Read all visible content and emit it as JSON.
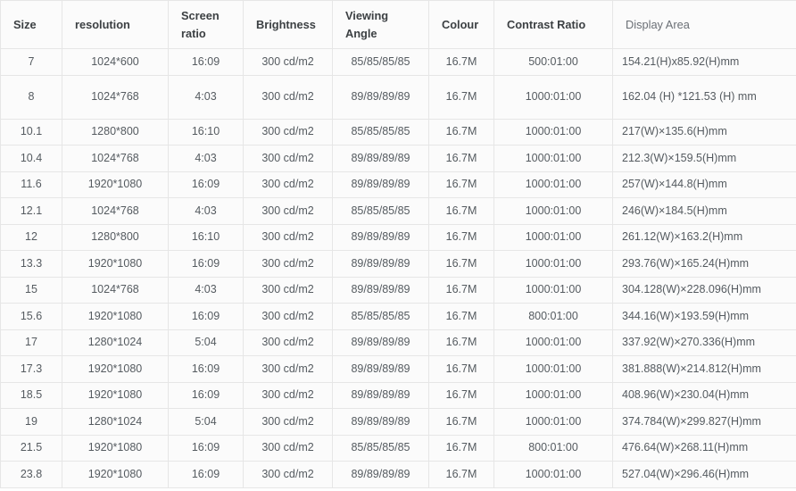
{
  "table": {
    "columns": [
      {
        "key": "size",
        "label": "Size"
      },
      {
        "key": "res",
        "label": "resolution"
      },
      {
        "key": "ratio",
        "label": "Screen\nratio"
      },
      {
        "key": "bright",
        "label": "Brightness"
      },
      {
        "key": "angle",
        "label": "Viewing\nAngle"
      },
      {
        "key": "colour",
        "label": "Colour"
      },
      {
        "key": "contrast",
        "label": "Contrast Ratio"
      },
      {
        "key": "area",
        "label": "Display Area"
      }
    ],
    "headers": {
      "size": "Size",
      "resolution": "resolution",
      "screen_ratio_line1": "Screen",
      "screen_ratio_line2": "ratio",
      "brightness": "Brightness",
      "viewing_angle_line1": "Viewing",
      "viewing_angle_line2": "Angle",
      "colour": "Colour",
      "contrast_ratio": "Contrast Ratio",
      "display_area": "Display Area"
    },
    "rows": [
      {
        "size": "7",
        "resolution": "1024*600",
        "screen_ratio": "16:09",
        "brightness": "300 cd/m2",
        "viewing_angle": "85/85/85/85",
        "colour": "16.7M",
        "contrast_ratio": "500:01:00",
        "display_area": "154.21(H)x85.92(H)mm"
      },
      {
        "size": "8",
        "resolution": "1024*768",
        "screen_ratio": "4:03",
        "brightness": "300 cd/m2",
        "viewing_angle": "89/89/89/89",
        "colour": "16.7M",
        "contrast_ratio": "1000:01:00",
        "display_area": "162.04 (H) *121.53 (H) mm"
      },
      {
        "size": "10.1",
        "resolution": "1280*800",
        "screen_ratio": "16:10",
        "brightness": "300 cd/m2",
        "viewing_angle": "85/85/85/85",
        "colour": "16.7M",
        "contrast_ratio": "1000:01:00",
        "display_area": "217(W)×135.6(H)mm"
      },
      {
        "size": "10.4",
        "resolution": "1024*768",
        "screen_ratio": "4:03",
        "brightness": "300 cd/m2",
        "viewing_angle": "89/89/89/89",
        "colour": "16.7M",
        "contrast_ratio": "1000:01:00",
        "display_area": "212.3(W)×159.5(H)mm"
      },
      {
        "size": "11.6",
        "resolution": "1920*1080",
        "screen_ratio": "16:09",
        "brightness": "300 cd/m2",
        "viewing_angle": "89/89/89/89",
        "colour": "16.7M",
        "contrast_ratio": "1000:01:00",
        "display_area": "257(W)×144.8(H)mm"
      },
      {
        "size": "12.1",
        "resolution": "1024*768",
        "screen_ratio": "4:03",
        "brightness": "300 cd/m2",
        "viewing_angle": "85/85/85/85",
        "colour": "16.7M",
        "contrast_ratio": "1000:01:00",
        "display_area": "246(W)×184.5(H)mm"
      },
      {
        "size": "12",
        "resolution": "1280*800",
        "screen_ratio": "16:10",
        "brightness": "300 cd/m2",
        "viewing_angle": "89/89/89/89",
        "colour": "16.7M",
        "contrast_ratio": "1000:01:00",
        "display_area": "261.12(W)×163.2(H)mm"
      },
      {
        "size": "13.3",
        "resolution": "1920*1080",
        "screen_ratio": "16:09",
        "brightness": "300 cd/m2",
        "viewing_angle": "89/89/89/89",
        "colour": "16.7M",
        "contrast_ratio": "1000:01:00",
        "display_area": "293.76(W)×165.24(H)mm"
      },
      {
        "size": "15",
        "resolution": "1024*768",
        "screen_ratio": "4:03",
        "brightness": "300 cd/m2",
        "viewing_angle": "89/89/89/89",
        "colour": "16.7M",
        "contrast_ratio": "1000:01:00",
        "display_area": "304.128(W)×228.096(H)mm"
      },
      {
        "size": "15.6",
        "resolution": "1920*1080",
        "screen_ratio": "16:09",
        "brightness": "300 cd/m2",
        "viewing_angle": "85/85/85/85",
        "colour": "16.7M",
        "contrast_ratio": "800:01:00",
        "display_area": "344.16(W)×193.59(H)mm"
      },
      {
        "size": "17",
        "resolution": "1280*1024",
        "screen_ratio": "5:04",
        "brightness": "300 cd/m2",
        "viewing_angle": "89/89/89/89",
        "colour": "16.7M",
        "contrast_ratio": "1000:01:00",
        "display_area": "337.92(W)×270.336(H)mm"
      },
      {
        "size": "17.3",
        "resolution": "1920*1080",
        "screen_ratio": "16:09",
        "brightness": "300 cd/m2",
        "viewing_angle": "89/89/89/89",
        "colour": "16.7M",
        "contrast_ratio": "1000:01:00",
        "display_area": "381.888(W)×214.812(H)mm"
      },
      {
        "size": "18.5",
        "resolution": "1920*1080",
        "screen_ratio": "16:09",
        "brightness": "300 cd/m2",
        "viewing_angle": "89/89/89/89",
        "colour": "16.7M",
        "contrast_ratio": "1000:01:00",
        "display_area": "408.96(W)×230.04(H)mm"
      },
      {
        "size": "19",
        "resolution": "1280*1024",
        "screen_ratio": "5:04",
        "brightness": "300 cd/m2",
        "viewing_angle": "89/89/89/89",
        "colour": "16.7M",
        "contrast_ratio": "1000:01:00",
        "display_area": "374.784(W)×299.827(H)mm"
      },
      {
        "size": "21.5",
        "resolution": "1920*1080",
        "screen_ratio": "16:09",
        "brightness": "300 cd/m2",
        "viewing_angle": "85/85/85/85",
        "colour": "16.7M",
        "contrast_ratio": "800:01:00",
        "display_area": "476.64(W)×268.11(H)mm"
      },
      {
        "size": "23.8",
        "resolution": "1920*1080",
        "screen_ratio": "16:09",
        "brightness": "300 cd/m2",
        "viewing_angle": "89/89/89/89",
        "colour": "16.7M",
        "contrast_ratio": "1000:01:00",
        "display_area": "527.04(W)×296.46(H)mm"
      }
    ]
  },
  "colors": {
    "border": "#e6e6e6",
    "cell_background": "#fbfbfb",
    "cell_text": "#555b60",
    "header_text": "#3c4043",
    "area_header_text": "#6a6f75"
  }
}
